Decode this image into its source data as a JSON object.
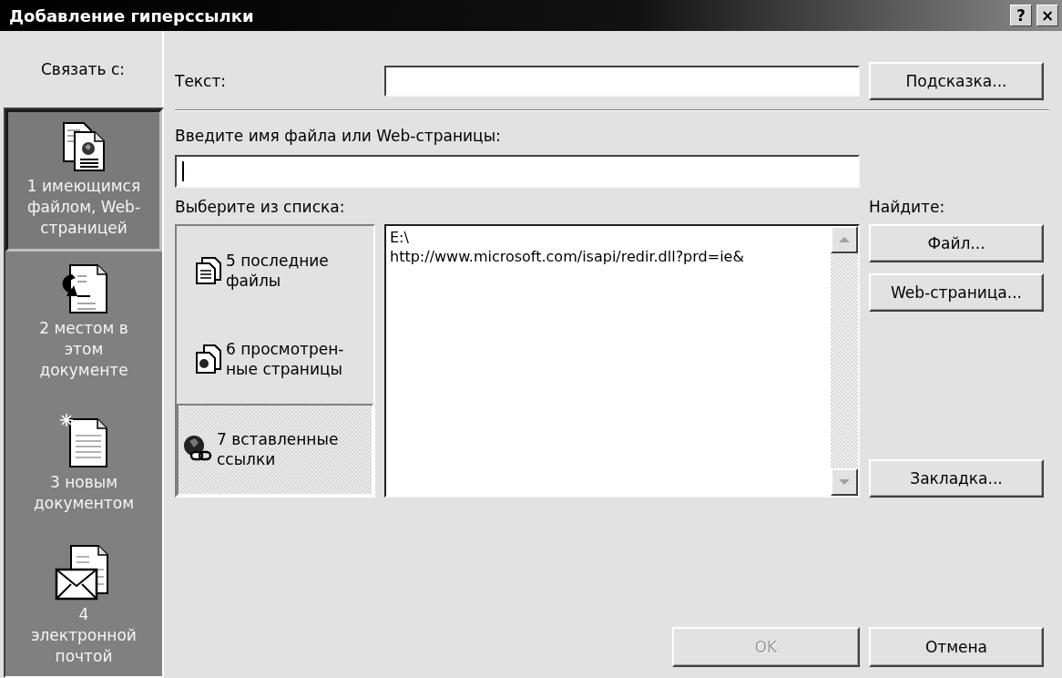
{
  "window": {
    "title": "Добавление гиперссылки",
    "controls": [
      {
        "kind": "help",
        "label": "?"
      },
      {
        "kind": "close",
        "label": "×"
      }
    ]
  },
  "link_to": {
    "label": "Связать с:",
    "items": [
      {
        "kind": "web-file",
        "label": "1 имеющимся\nфайлом, Web-\nстраницей",
        "selected": true
      },
      {
        "kind": "place",
        "label": "2 местом в\nэтом\nдокументе",
        "selected": false
      },
      {
        "kind": "new-doc",
        "label": "3 новым\nдокументом",
        "selected": false
      },
      {
        "kind": "email",
        "label": "4\nэлектронной\nпочтой",
        "selected": false
      }
    ]
  },
  "text_field": {
    "label": "Текст:"
  },
  "hint_button": {
    "label": "Подсказка..."
  },
  "address_field": {
    "label": "Введите имя файла или Web-страницы:",
    "focused": true
  },
  "choose_label": "Выберите из списка:",
  "sources": [
    {
      "kind": "recent",
      "label": "5 последние\nфайлы",
      "selected": false
    },
    {
      "kind": "browsed",
      "label": "6 просмотрен-\nные страницы",
      "selected": false
    },
    {
      "kind": "inserted",
      "label": "7 вставленные\nссылки",
      "selected": true
    }
  ],
  "list_items": [
    "E:\\",
    "http://www.microsoft.com/isapi/redir.dll?prd=ie&"
  ],
  "find": {
    "label": "Найдите:",
    "buttons": [
      {
        "kind": "file",
        "label": "Файл..."
      },
      {
        "kind": "web",
        "label": "Web-страница..."
      },
      {
        "kind": "bookmark",
        "label": "Закладка..."
      }
    ]
  },
  "ok_button": {
    "label": "OK",
    "disabled": true
  },
  "cancel_button": {
    "label": "Отмена",
    "disabled": false
  }
}
